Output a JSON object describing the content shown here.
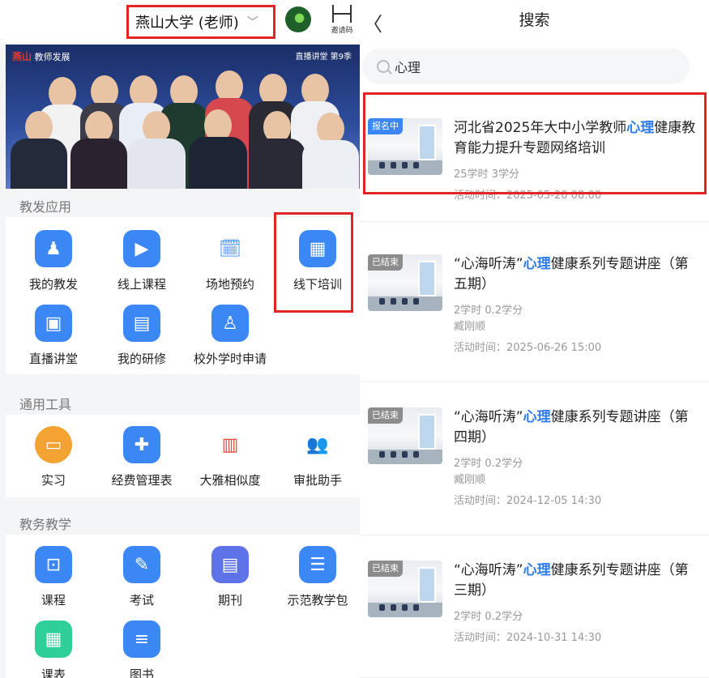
{
  "left": {
    "school_name": "燕山大学 (老师)",
    "invite_label": "邀请码",
    "banner": {
      "logo_mark": "燕山",
      "logo_text": "教师发展",
      "season": "直播讲堂  第9季"
    },
    "sections": [
      {
        "title": "教发应用",
        "apps": [
          {
            "label": "我的教发",
            "icon": "person-icon"
          },
          {
            "label": "线上课程",
            "icon": "screen-icon"
          },
          {
            "label": "场地预约",
            "icon": "calendar-clock-icon"
          },
          {
            "label": "线下培训",
            "icon": "presentation-icon"
          },
          {
            "label": "直播讲堂",
            "icon": "tv-icon"
          },
          {
            "label": "我的研修",
            "icon": "notebook-icon"
          },
          {
            "label": "校外学时申请",
            "icon": "user-badge-icon"
          }
        ]
      },
      {
        "title": "通用工具",
        "apps": [
          {
            "label": "实习",
            "icon": "document-badge-icon"
          },
          {
            "label": "经费管理表",
            "icon": "clipboard-icon"
          },
          {
            "label": "大雅相似度",
            "icon": "doc-search-icon"
          },
          {
            "label": "审批助手",
            "icon": "users-icon"
          }
        ]
      },
      {
        "title": "教务教学",
        "apps": [
          {
            "label": "课程",
            "icon": "board-icon"
          },
          {
            "label": "考试",
            "icon": "edit-icon"
          },
          {
            "label": "期刊",
            "icon": "journal-icon"
          },
          {
            "label": "示范教学包",
            "icon": "stack-icon"
          },
          {
            "label": "课表",
            "icon": "timetable-icon"
          },
          {
            "label": "图书",
            "icon": "books-icon"
          }
        ]
      }
    ]
  },
  "right": {
    "title": "搜索",
    "search_query": "心理",
    "results": [
      {
        "tag": "报名中",
        "title_pre": "河北省2025年大中小学教师",
        "title_kw": "心理",
        "title_post": "健康教育能力提升专题网络培训",
        "credits": "25学时   3学分",
        "speaker": "",
        "time": "活动时间：2025-05-20 08:00"
      },
      {
        "tag": "已结束",
        "title_pre": "“心海听涛”",
        "title_kw": "心理",
        "title_post": "健康系列专题讲座（第五期）",
        "credits": "2学时   0.2学分",
        "speaker": "臧刚顺",
        "time": "活动时间：2025-06-26 15:00"
      },
      {
        "tag": "已结束",
        "title_pre": "“心海听涛”",
        "title_kw": "心理",
        "title_post": "健康系列专题讲座（第四期）",
        "credits": "2学时   0.2学分",
        "speaker": "臧刚顺",
        "time": "活动时间：2024-12-05 14:30"
      },
      {
        "tag": "已结束",
        "title_pre": "“心海听涛”",
        "title_kw": "心理",
        "title_post": "健康系列专题讲座（第三期）",
        "credits": "2学时   0.2学分",
        "speaker": "",
        "time": "活动时间：2024-10-31 14:30"
      }
    ]
  }
}
